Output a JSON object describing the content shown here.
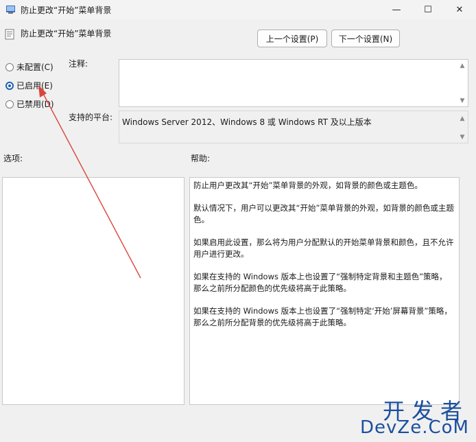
{
  "window": {
    "title": "防止更改“开始”菜单背景",
    "minimize_glyph": "—",
    "maximize_glyph": "☐",
    "close_glyph": "✕"
  },
  "header": {
    "policy_title": "防止更改“开始”菜单背景",
    "prev_button": "上一个设置(P)",
    "next_button": "下一个设置(N)"
  },
  "state": {
    "options": [
      {
        "label": "未配置(C)",
        "checked": false
      },
      {
        "label": "已启用(E)",
        "checked": true
      },
      {
        "label": "已禁用(D)",
        "checked": false
      }
    ]
  },
  "comment": {
    "label": "注释:",
    "value": ""
  },
  "platform": {
    "label": "支持的平台:",
    "value": "Windows Server 2012、Windows 8 或 Windows RT 及以上版本"
  },
  "options_panel": {
    "label": "选项:"
  },
  "help_panel": {
    "label": "帮助:",
    "paragraphs": [
      "防止用户更改其“开始”菜单背景的外观，如背景的颜色或主题色。",
      "默认情况下，用户可以更改其“开始”菜单背景的外观，如背景的颜色或主题色。",
      "如果启用此设置，那么将为用户分配默认的开始菜单背景和颜色，且不允许用户进行更改。",
      "如果在支持的 Windows 版本上也设置了“强制特定背景和主题色”策略，那么之前所分配颜色的优先级将高于此策略。",
      "如果在支持的 Windows 版本上也设置了“强制特定‘开始’屏幕背景”策略，那么之前所分配背景的优先级将高于此策略。"
    ]
  },
  "watermark": {
    "top": "开发者",
    "bottom": "DevZe.CoM"
  },
  "colors": {
    "accent": "#1a5fb4",
    "annotation_arrow": "#d9453a",
    "watermark": "#1b4f9e"
  }
}
